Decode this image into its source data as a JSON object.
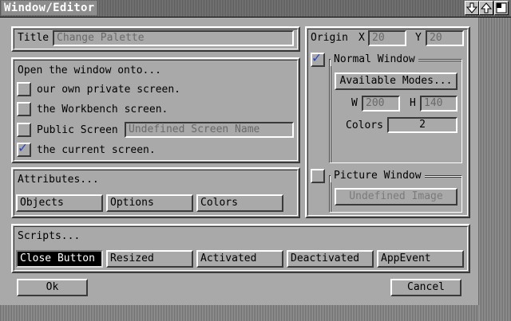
{
  "window": {
    "title": "Window/Editor"
  },
  "title_gadget": {
    "label": "Title",
    "value": "Change Palette"
  },
  "open_onto": {
    "heading": "Open the window onto...",
    "options": [
      {
        "label": "our own private screen.",
        "checked": false
      },
      {
        "label": "the Workbench screen.",
        "checked": false
      },
      {
        "label": "Public Screen",
        "checked": false
      },
      {
        "label": "the current screen.",
        "checked": true
      }
    ],
    "public_screen_value": "Undefined Screen Name"
  },
  "attributes": {
    "heading": "Attributes...",
    "buttons": [
      "Objects",
      "Options",
      "Colors"
    ]
  },
  "origin": {
    "label": "Origin",
    "x_label": "X",
    "x_value": "20",
    "y_label": "Y",
    "y_value": "20"
  },
  "normal_window": {
    "label": "Normal Window",
    "checked": true,
    "modes_button": "Available Modes...",
    "w_label": "W",
    "w_value": "200",
    "h_label": "H",
    "h_value": "140",
    "colors_label": "Colors",
    "colors_value": "2"
  },
  "picture_window": {
    "label": "Picture Window",
    "checked": false,
    "image_button": "Undefined Image"
  },
  "scripts": {
    "heading": "Scripts...",
    "buttons": [
      "Close Button",
      "Resized",
      "Activated",
      "Deactivated",
      "AppEvent"
    ],
    "selected": "Close Button"
  },
  "footer": {
    "ok": "Ok",
    "cancel": "Cancel"
  },
  "check_mark": "✓",
  "colors": {
    "background": "#a9a9a9",
    "check": "#2a44c8"
  }
}
